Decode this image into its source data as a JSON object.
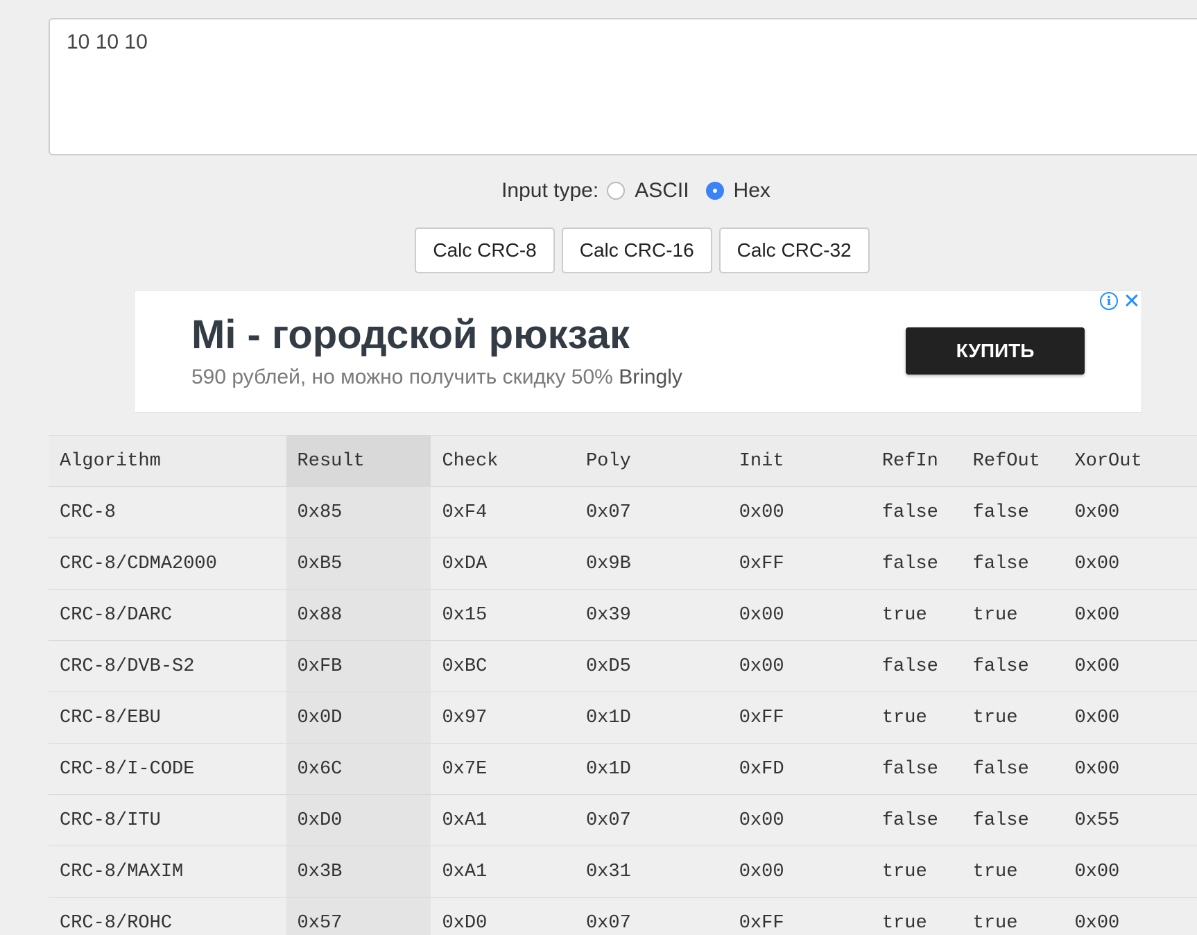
{
  "input": {
    "value": "10 10 10"
  },
  "input_type": {
    "label": "Input type:",
    "options": [
      {
        "label": "ASCII",
        "checked": false
      },
      {
        "label": "Hex",
        "checked": true
      }
    ]
  },
  "buttons": {
    "crc8": "Calc CRC-8",
    "crc16": "Calc CRC-16",
    "crc32": "Calc CRC-32"
  },
  "ad": {
    "title": "Mi - городской рюкзак",
    "subtitle": "590 рублей, но можно получить скидку 50%",
    "brand": "Bringly",
    "buy_label": "КУПИТЬ",
    "info_icon": "info-icon",
    "close_icon": "close-icon",
    "accent_color": "#1e90ff"
  },
  "table": {
    "headers": [
      "Algorithm",
      "Result",
      "Check",
      "Poly",
      "Init",
      "RefIn",
      "RefOut",
      "XorOut"
    ],
    "rows": [
      [
        "CRC-8",
        "0x85",
        "0xF4",
        "0x07",
        "0x00",
        "false",
        "false",
        "0x00"
      ],
      [
        "CRC-8/CDMA2000",
        "0xB5",
        "0xDA",
        "0x9B",
        "0xFF",
        "false",
        "false",
        "0x00"
      ],
      [
        "CRC-8/DARC",
        "0x88",
        "0x15",
        "0x39",
        "0x00",
        "true",
        "true",
        "0x00"
      ],
      [
        "CRC-8/DVB-S2",
        "0xFB",
        "0xBC",
        "0xD5",
        "0x00",
        "false",
        "false",
        "0x00"
      ],
      [
        "CRC-8/EBU",
        "0x0D",
        "0x97",
        "0x1D",
        "0xFF",
        "true",
        "true",
        "0x00"
      ],
      [
        "CRC-8/I-CODE",
        "0x6C",
        "0x7E",
        "0x1D",
        "0xFD",
        "false",
        "false",
        "0x00"
      ],
      [
        "CRC-8/ITU",
        "0xD0",
        "0xA1",
        "0x07",
        "0x00",
        "false",
        "false",
        "0x55"
      ],
      [
        "CRC-8/MAXIM",
        "0x3B",
        "0xA1",
        "0x31",
        "0x00",
        "true",
        "true",
        "0x00"
      ],
      [
        "CRC-8/ROHC",
        "0x57",
        "0xD0",
        "0x07",
        "0xFF",
        "true",
        "true",
        "0x00"
      ]
    ]
  }
}
